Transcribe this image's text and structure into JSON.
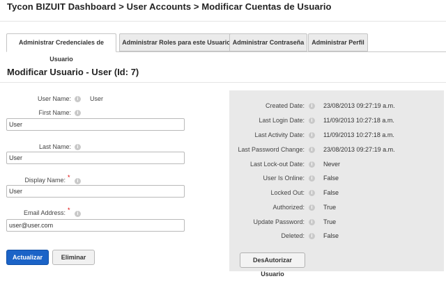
{
  "breadcrumb": "Tycon BIZUIT Dashboard > User Accounts > Modificar Cuentas de Usuario",
  "tabs": [
    {
      "label": "Administrar Credenciales de Usuario",
      "active": true
    },
    {
      "label": "Administrar Roles para este Usuario",
      "active": false
    },
    {
      "label": "Administrar Contraseña",
      "active": false
    },
    {
      "label": "Administrar Perfil",
      "active": false
    }
  ],
  "section_title": "Modificar Usuario - User (Id: 7)",
  "form": {
    "username_label": "User Name:",
    "username_value": "User",
    "first_name_label": "First Name:",
    "first_name_value": "User",
    "last_name_label": "Last Name:",
    "last_name_value": "User",
    "display_name_label": "Display Name:",
    "display_name_value": "User",
    "email_label": "Email Address:",
    "email_value": "user@user.com",
    "required_mark": "*",
    "info_glyph": "i"
  },
  "buttons": {
    "update": "Actualizar",
    "delete": "Eliminar",
    "unauthorize": "DesAutorizar Usuario"
  },
  "details": [
    {
      "label": "Created Date:",
      "value": "23/08/2013 09:27:19 a.m."
    },
    {
      "label": "Last Login Date:",
      "value": "11/09/2013 10:27:18 a.m."
    },
    {
      "label": "Last Activity Date:",
      "value": "11/09/2013 10:27:18 a.m."
    },
    {
      "label": "Last Password Change:",
      "value": "23/08/2013 09:27:19 a.m."
    },
    {
      "label": "Last Lock-out Date:",
      "value": "Never"
    },
    {
      "label": "User Is Online:",
      "value": "False"
    },
    {
      "label": "Locked Out:",
      "value": "False"
    },
    {
      "label": "Authorized:",
      "value": "True"
    },
    {
      "label": "Update Password:",
      "value": "True"
    },
    {
      "label": "Deleted:",
      "value": "False"
    }
  ],
  "colors": {
    "primary": "#1b63c7",
    "required": "#dd0000",
    "panel": "#e9e9e9"
  }
}
